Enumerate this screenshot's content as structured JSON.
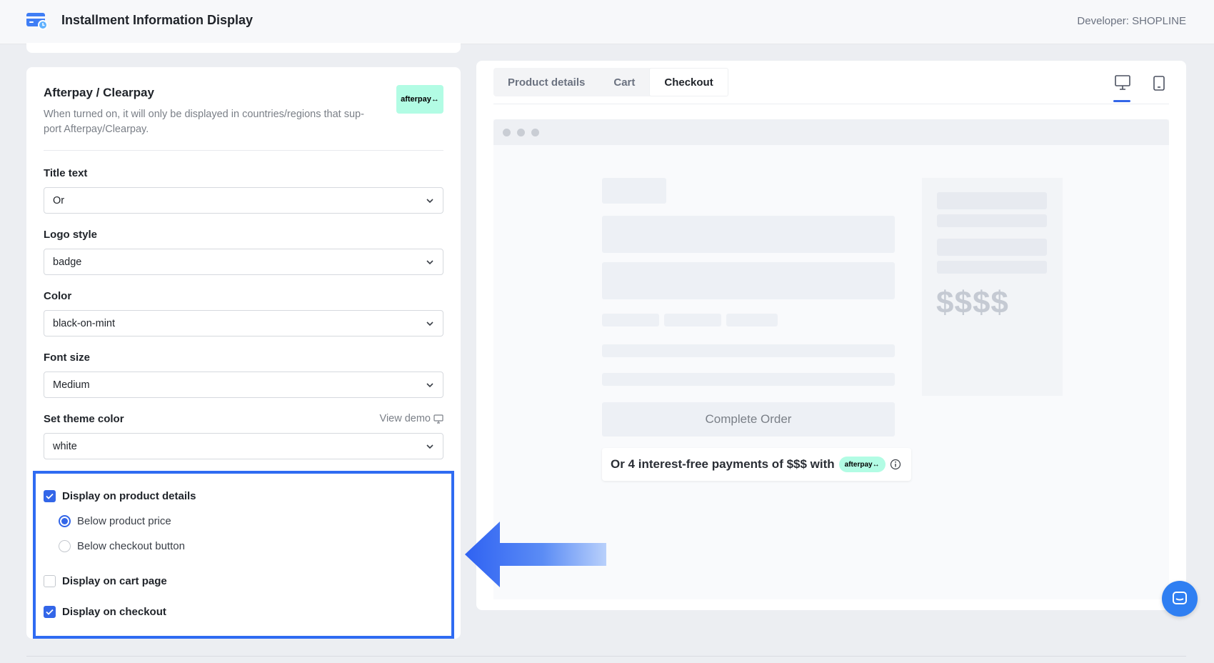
{
  "header": {
    "title": "Installment Information Display",
    "developer": "Developer: SHOPLINE"
  },
  "settings": {
    "section_title": "Afterpay / Clearpay",
    "section_desc": "When turned on, it will only be displayed in countries/regions that sup-port Afterpay/Clearpay.",
    "logo_text": "afterpay↔",
    "title_text_label": "Title text",
    "title_text_value": "Or",
    "logo_style_label": "Logo style",
    "logo_style_value": "badge",
    "color_label": "Color",
    "color_value": "black-on-mint",
    "font_size_label": "Font size",
    "font_size_value": "Medium",
    "theme_color_label": "Set theme color",
    "theme_color_value": "white",
    "view_demo": "View demo"
  },
  "display_options": {
    "product_details": {
      "label": "Display on product details",
      "checked": true
    },
    "below_price": {
      "label": "Below product price",
      "selected": true
    },
    "below_checkout": {
      "label": "Below checkout button",
      "selected": false
    },
    "cart_page": {
      "label": "Display on cart page",
      "checked": false
    },
    "checkout": {
      "label": "Display on checkout",
      "checked": true
    }
  },
  "preview": {
    "tabs": [
      "Product details",
      "Cart",
      "Checkout"
    ],
    "active_tab": "Checkout",
    "price_placeholder": "$$$$",
    "complete_order": "Complete Order",
    "installment_text": "Or 4 interest-free payments of $$$ with",
    "badge_text": "afterpay↔"
  },
  "colors": {
    "accent": "#3366e8",
    "afterpay_mint": "#b2fce4",
    "highlight_border": "#2f6bf2"
  },
  "icons": [
    "app-card-icon",
    "chevron-down-icon",
    "desktop-icon",
    "tablet-icon",
    "info-icon",
    "chat-icon",
    "left-arrow"
  ]
}
